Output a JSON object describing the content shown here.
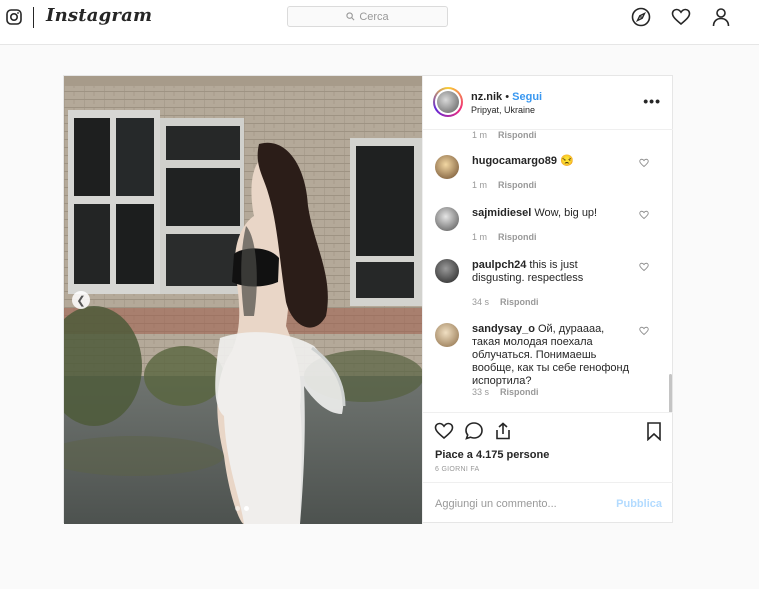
{
  "header": {
    "logo_text": "Instagram",
    "search_placeholder": "Cerca",
    "icons": [
      "instagram-glyph-icon",
      "compass-icon",
      "heart-icon",
      "profile-icon"
    ]
  },
  "post": {
    "username": "nz.nik",
    "follow_separator": " • ",
    "follow_label": "Segui",
    "location": "Pripyat, Ukraine",
    "more_label": "•••",
    "carousel": {
      "total": 2,
      "active": 2
    },
    "top_meta": {
      "time": "1 m",
      "reply": "Rispondi"
    },
    "comments": [
      {
        "user": "hugocamargo89",
        "text": "😒",
        "time": "1 m",
        "reply": "Rispondi",
        "avatar_color": "#e8c27d"
      },
      {
        "user": "sajmidiesel",
        "text": "Wow, big up!",
        "time": "1 m",
        "reply": "Rispondi",
        "avatar_color": "#8a8a8a"
      },
      {
        "user": "paulpch24",
        "text": "this is just disgusting. respectless",
        "time": "34 s",
        "reply": "Rispondi",
        "avatar_color": "#4a4a4a"
      },
      {
        "user": "sandysay_o",
        "text": "Ой, дураааа, такая молодая поехала облучаться. Понимаешь вообще, как ты себе генофонд испортила?",
        "time": "33 s",
        "reply": "Rispondi",
        "avatar_color": "#c9b08a"
      }
    ],
    "likes_label": "Piace a 4.175 persone",
    "time_ago": "6 GIORNI FA",
    "add_comment_placeholder": "Aggiungi un commento...",
    "publish_label": "Pubblica"
  }
}
